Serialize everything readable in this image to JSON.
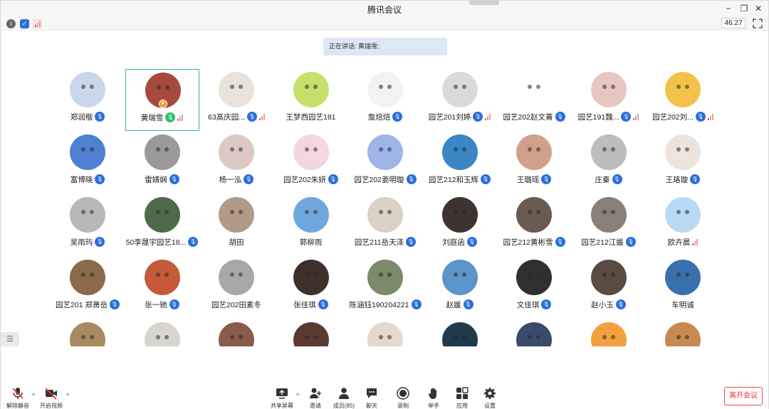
{
  "window": {
    "title": "腾讯会议"
  },
  "infobar": {
    "timer": "46:27"
  },
  "speaking": {
    "text": "正在讲话: 黄瑞雪;"
  },
  "participants": [
    {
      "name": "郑润楷",
      "mic": "blue",
      "color": "#c8d7e9"
    },
    {
      "name": "黄瑞雪",
      "mic": "green",
      "color": "#a54a3d",
      "active": true,
      "signal": true,
      "host": true
    },
    {
      "name": "63高庆园...",
      "mic": "blue",
      "color": "#e9e2da",
      "signal": true
    },
    {
      "name": "王梦西园艺181",
      "mic": "none",
      "color": "#c6df6a"
    },
    {
      "name": "詹焙焙",
      "mic": "blue",
      "color": "#f2f2f2"
    },
    {
      "name": "园艺201刘婷",
      "mic": "blue",
      "color": "#dadada",
      "signal": true
    },
    {
      "name": "园艺202赵文菁",
      "mic": "blue",
      "color": "#ffffff"
    },
    {
      "name": "园艺191魏...",
      "mic": "blue",
      "color": "#e6c7c0",
      "signal": true
    },
    {
      "name": "园艺202刘...",
      "mic": "blue",
      "color": "#f2c24a",
      "signal": true
    },
    {
      "name": "富博晓",
      "mic": "blue",
      "color": "#4f7fd0"
    },
    {
      "name": "雷婧娴",
      "mic": "blue",
      "color": "#9a9a9a"
    },
    {
      "name": "杨一泓",
      "mic": "blue",
      "color": "#dcc9c4"
    },
    {
      "name": "园艺202朱妍",
      "mic": "blue",
      "color": "#f2d7de"
    },
    {
      "name": "园艺202姜明璇",
      "mic": "blue",
      "color": "#9fb5e8"
    },
    {
      "name": "园艺212和玉辉",
      "mic": "blue",
      "color": "#3b86c4"
    },
    {
      "name": "王璐瑶",
      "mic": "blue",
      "color": "#d1a08a"
    },
    {
      "name": "庄秦",
      "mic": "blue",
      "color": "#bdbdbd"
    },
    {
      "name": "王珞璇",
      "mic": "blue",
      "color": "#ece3dc"
    },
    {
      "name": "吴雨玙",
      "mic": "blue",
      "color": "#b8b8b8"
    },
    {
      "name": "50李晟宇园艺18...",
      "mic": "blue",
      "color": "#4e6a4a"
    },
    {
      "name": "胡田",
      "mic": "none",
      "color": "#b29a86"
    },
    {
      "name": "郭柳雨",
      "mic": "none",
      "color": "#6fa7dd"
    },
    {
      "name": "园艺211岳天泽",
      "mic": "blue",
      "color": "#dcd1c5"
    },
    {
      "name": "刘庭函",
      "mic": "blue",
      "color": "#3d3431"
    },
    {
      "name": "园艺212黄彬雪",
      "mic": "blue",
      "color": "#6a5a50"
    },
    {
      "name": "园艺212江媛",
      "mic": "blue",
      "color": "#8a8078"
    },
    {
      "name": "欧卉晨",
      "mic": "none",
      "color": "#b9daf4",
      "signal": true
    },
    {
      "name": "园艺201 郑萧岳",
      "mic": "blue",
      "color": "#8a6a4a"
    },
    {
      "name": "张一驰",
      "mic": "blue",
      "color": "#c45a3a"
    },
    {
      "name": "园艺202田素冬",
      "mic": "none",
      "color": "#a8a8a8"
    },
    {
      "name": "张佳琪",
      "mic": "blue",
      "color": "#3d2f2a"
    },
    {
      "name": "陈涵钰190204221",
      "mic": "blue",
      "color": "#7b8a6a"
    },
    {
      "name": "赵媛",
      "mic": "blue",
      "color": "#5a96c9"
    },
    {
      "name": "文佳琪",
      "mic": "blue",
      "color": "#2f2f2f"
    },
    {
      "name": "赵小玉",
      "mic": "blue",
      "color": "#5a4a42"
    },
    {
      "name": "车明诚",
      "mic": "none",
      "color": "#3a6fae"
    },
    {
      "name": "",
      "mic": "none",
      "color": "#a88a60"
    },
    {
      "name": "",
      "mic": "none",
      "color": "#d8d4d0"
    },
    {
      "name": "",
      "mic": "none",
      "color": "#8a5a4a"
    },
    {
      "name": "",
      "mic": "none",
      "color": "#5a3a30"
    },
    {
      "name": "",
      "mic": "none",
      "color": "#e5d9cf"
    },
    {
      "name": "",
      "mic": "none",
      "color": "#1f3a4a"
    },
    {
      "name": "",
      "mic": "none",
      "color": "#3a4a6a"
    },
    {
      "name": "",
      "mic": "none",
      "color": "#f5a040"
    },
    {
      "name": "",
      "mic": "none",
      "color": "#c88a50"
    }
  ],
  "bottombar": {
    "unmute": "解除静音",
    "start_video": "开启视频",
    "share": "共享屏幕",
    "invite": "邀请",
    "members": "成员(85)",
    "chat": "聊天",
    "record": "录制",
    "raise_hand": "举手",
    "apps": "应用",
    "settings": "设置",
    "leave": "离开会议"
  },
  "colors": {
    "accent": "#2a6fdb",
    "active_border": "#2fbf71",
    "leave": "#e33333"
  }
}
